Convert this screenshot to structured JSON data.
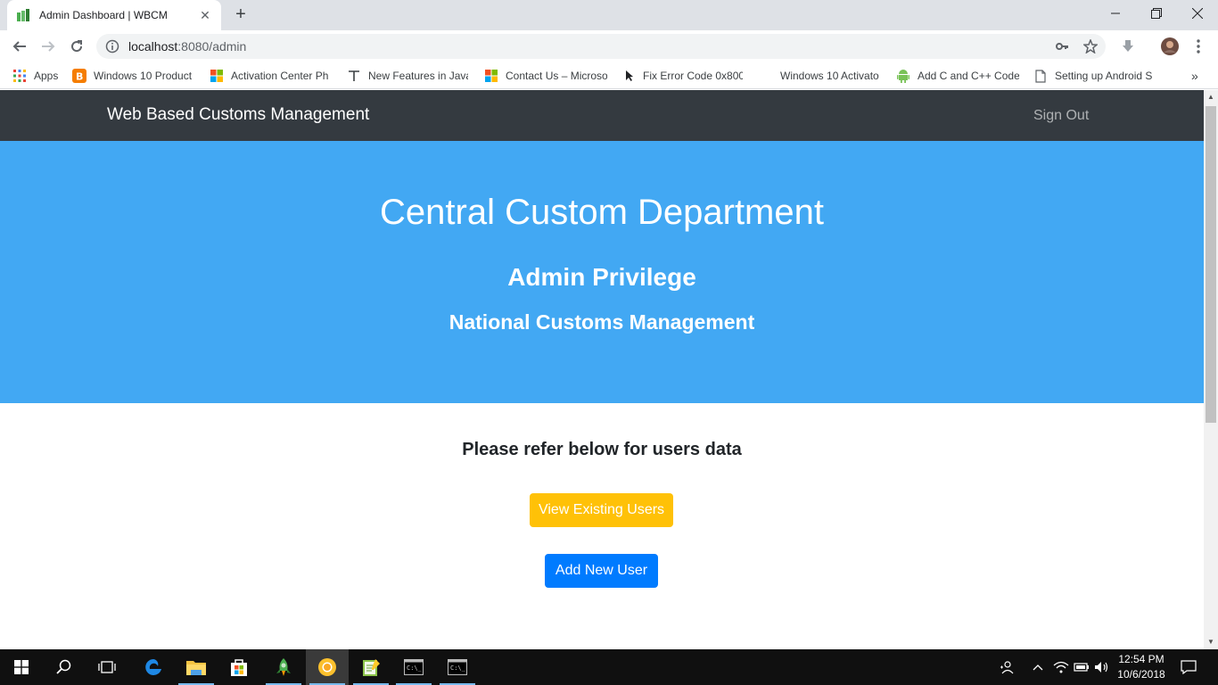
{
  "browser": {
    "tab_title": "Admin Dashboard | WBCM",
    "tab_close": "✕",
    "new_tab": "+",
    "url_host": "localhost",
    "url_rest": ":8080/admin",
    "bookmarks": [
      {
        "label": "Apps",
        "icon": "apps-grid-icon"
      },
      {
        "label": "Windows 10 Product",
        "icon": "blogger-icon"
      },
      {
        "label": "Activation Center Ph",
        "icon": "microsoft-icon"
      },
      {
        "label": "New Features in Java",
        "icon": "text-t-icon"
      },
      {
        "label": "Contact Us – Microso",
        "icon": "microsoft-icon"
      },
      {
        "label": "Fix Error Code 0x800",
        "icon": "cursor-icon"
      },
      {
        "label": "Windows 10 Activato",
        "icon": "blank-icon"
      },
      {
        "label": "Add C and C++ Code",
        "icon": "android-icon"
      },
      {
        "label": "Setting up Android S",
        "icon": "page-icon"
      }
    ],
    "bookmarks_overflow": "»"
  },
  "page": {
    "brand": "Web Based Customs Management",
    "sign_out": "Sign Out",
    "hero_title": "Central Custom Department",
    "hero_subtitle": "Admin Privilege",
    "hero_tagline": "National Customs Management",
    "content_title": "Please refer below for users data",
    "view_users_button": "View Existing Users",
    "add_user_button": "Add New User"
  },
  "taskbar": {
    "time": "12:54 PM",
    "date": "10/6/2018"
  },
  "colors": {
    "navbar": "#343a40",
    "hero": "#42a8f3",
    "warning": "#ffc107",
    "primary": "#007bff"
  }
}
